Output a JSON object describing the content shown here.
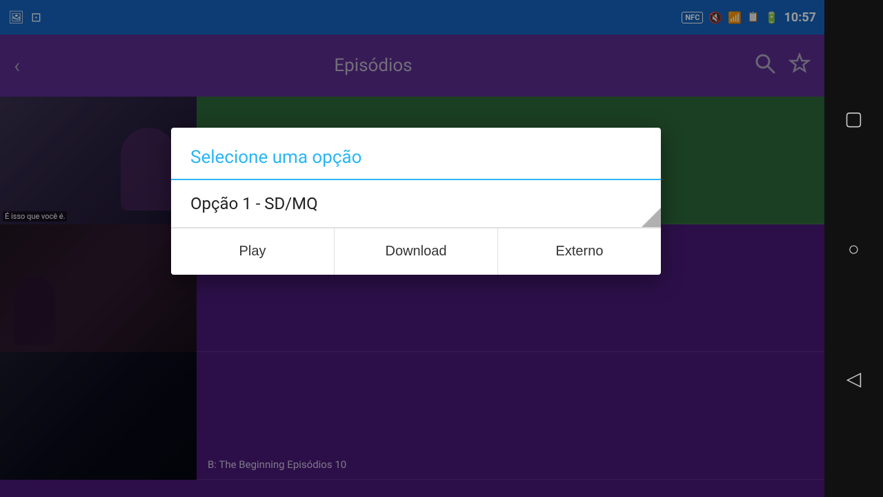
{
  "statusBar": {
    "leftIcons": [
      "image-icon",
      "notification-icon"
    ],
    "nfc": "NFC",
    "time": "10:57",
    "icons": [
      "mute-icon",
      "wifi-icon",
      "sim-icon",
      "battery-icon"
    ]
  },
  "appBar": {
    "backLabel": "‹",
    "title": "Episódios",
    "searchLabel": "⌕",
    "favoriteLabel": "☆"
  },
  "dialog": {
    "title": "Selecione uma opção",
    "option": "Opção 1 - SD/MQ",
    "buttons": {
      "play": "Play",
      "download": "Download",
      "external": "Externo"
    }
  },
  "episodes": [
    {
      "subtitle": "É isso que você é.",
      "title": ""
    },
    {
      "subtitle": "",
      "title": ""
    },
    {
      "subtitle": "B: The Beginning Episódios 10",
      "title": ""
    }
  ],
  "androidNav": {
    "square": "▢",
    "circle": "○",
    "triangle": "◁"
  }
}
